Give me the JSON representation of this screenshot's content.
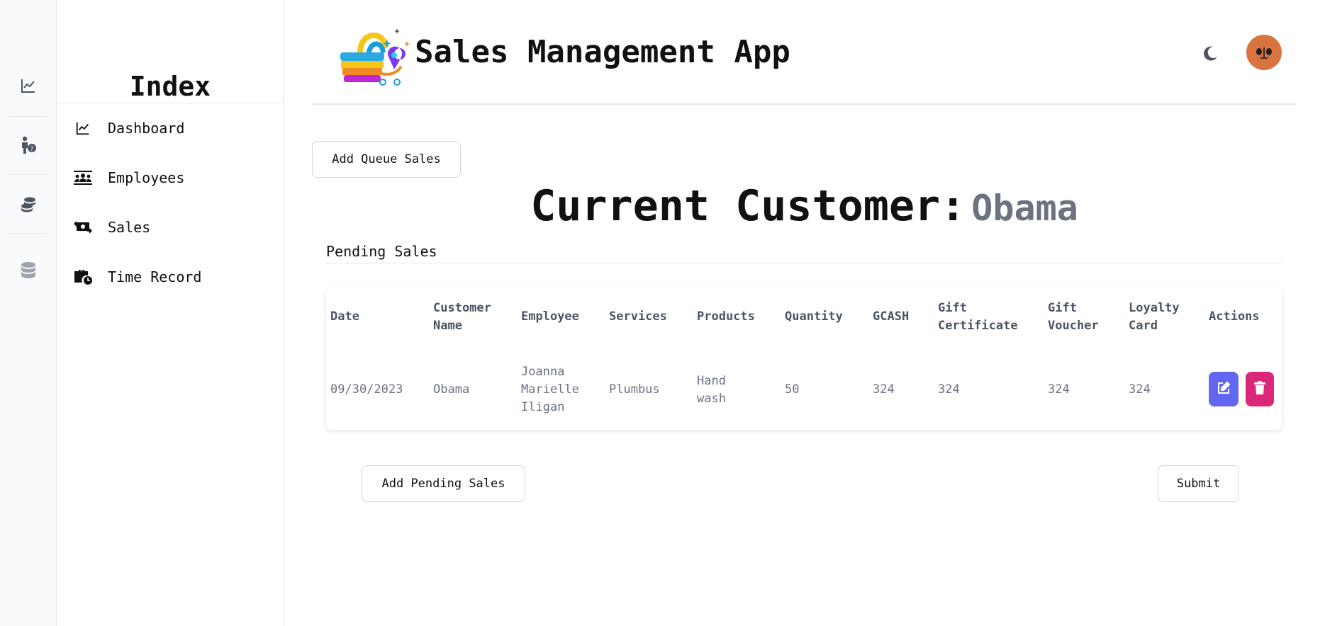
{
  "header": {
    "title": "Sales Management App"
  },
  "sidebar": {
    "title": "Index",
    "items": [
      {
        "label": "Dashboard",
        "icon": "chart-line-icon"
      },
      {
        "label": "Employees",
        "icon": "people-group-icon"
      },
      {
        "label": "Sales",
        "icon": "money-exchange-icon"
      },
      {
        "label": "Time Record",
        "icon": "briefcase-clock-icon"
      }
    ]
  },
  "rail": {
    "icons": [
      "chart-line-icon",
      "person-question-icon",
      "coins-icon",
      "database-icon"
    ]
  },
  "actions": {
    "add_queue": "Add Queue Sales",
    "add_pending": "Add Pending Sales",
    "submit": "Submit"
  },
  "customer": {
    "label": "Current Customer:",
    "name": "Obama"
  },
  "pending": {
    "title": "Pending Sales",
    "columns": [
      [
        "Date"
      ],
      [
        "Customer",
        "Name"
      ],
      [
        "Employee"
      ],
      [
        "Services"
      ],
      [
        "Products"
      ],
      [
        "Quantity"
      ],
      [
        "GCASH"
      ],
      [
        "Gift",
        "Certificate"
      ],
      [
        "Gift",
        "Voucher"
      ],
      [
        "Loyalty",
        "Card"
      ],
      [
        "Actions"
      ]
    ],
    "rows": [
      {
        "date": "09/30/2023",
        "customer": "Obama",
        "employee": [
          "Joanna",
          "Marielle",
          "Iligan"
        ],
        "services": "Plumbus",
        "products": [
          "Hand",
          "wash"
        ],
        "quantity": "50",
        "gcash": "324",
        "gift_certificate": "324",
        "gift_voucher": "324",
        "loyalty_card": "324"
      }
    ]
  },
  "colors": {
    "edit": "#6366f1",
    "delete": "#db2777",
    "avatar": "#d9733f",
    "muted_text": "#6b7280"
  }
}
